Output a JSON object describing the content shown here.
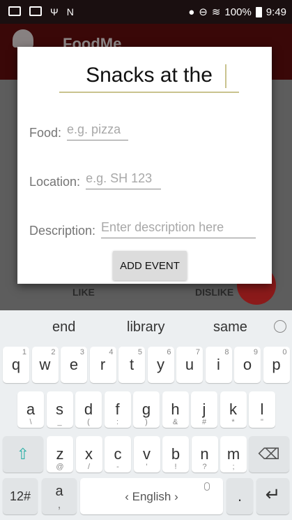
{
  "status_bar": {
    "battery": "100%",
    "time": "9:49"
  },
  "app": {
    "title": "FoodMe",
    "like_label": "LIKE",
    "dislike_label": "DISLIKE"
  },
  "dialog": {
    "title_value": "Snacks at the",
    "food": {
      "label": "Food:",
      "placeholder": "e.g. pizza"
    },
    "location": {
      "label": "Location:",
      "placeholder": "e.g. SH 123"
    },
    "description": {
      "label": "Description:",
      "placeholder": "Enter description here"
    },
    "add_event_label": "ADD EVENT"
  },
  "keyboard": {
    "suggestions": [
      "end",
      "library",
      "same"
    ],
    "row1": [
      {
        "k": "q",
        "h": "1"
      },
      {
        "k": "w",
        "h": "2"
      },
      {
        "k": "e",
        "h": "3"
      },
      {
        "k": "r",
        "h": "4"
      },
      {
        "k": "t",
        "h": "5"
      },
      {
        "k": "y",
        "h": "6"
      },
      {
        "k": "u",
        "h": "7"
      },
      {
        "k": "i",
        "h": "8"
      },
      {
        "k": "o",
        "h": "9"
      },
      {
        "k": "p",
        "h": "0"
      }
    ],
    "row2": [
      {
        "k": "a",
        "s": "\\"
      },
      {
        "k": "s",
        "s": "_"
      },
      {
        "k": "d",
        "s": "("
      },
      {
        "k": "f",
        "s": ":"
      },
      {
        "k": "g",
        "s": ")"
      },
      {
        "k": "h",
        "s": "&"
      },
      {
        "k": "j",
        "s": "#"
      },
      {
        "k": "k",
        "s": "*"
      },
      {
        "k": "l",
        "s": "\""
      }
    ],
    "row3": [
      {
        "k": "z",
        "s": "@"
      },
      {
        "k": "x",
        "s": "/"
      },
      {
        "k": "c",
        "s": "-"
      },
      {
        "k": "v",
        "s": "'"
      },
      {
        "k": "b",
        "s": "!"
      },
      {
        "k": "n",
        "s": "?"
      },
      {
        "k": "m",
        "s": ";"
      }
    ],
    "symbols_label": "12#",
    "comma_key": "a",
    "comma_sub": ",",
    "space_label": "‹ English ›",
    "period_key": ".",
    "enter_icon": "↵"
  }
}
